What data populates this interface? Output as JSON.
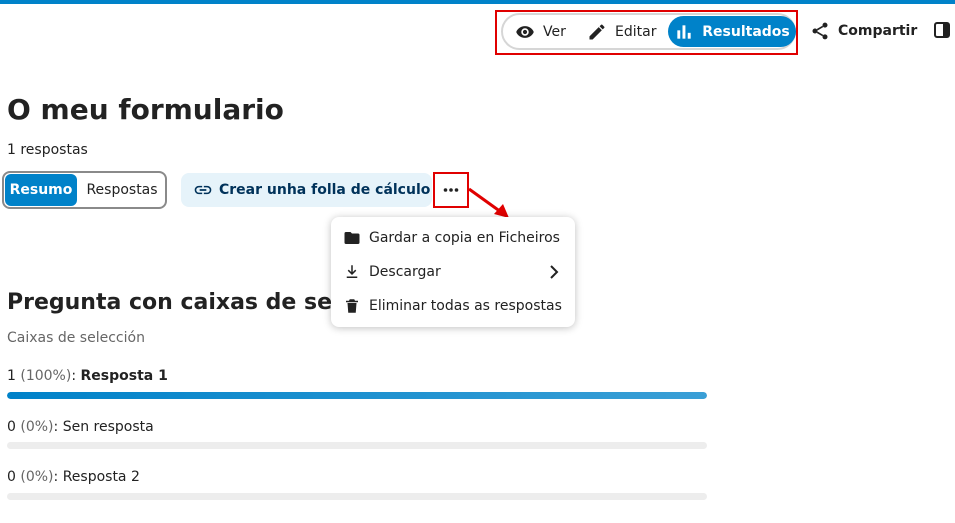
{
  "header": {
    "view_switch": {
      "ver_label": "Ver",
      "editar_label": "Editar",
      "resultados_label": "Resultados"
    },
    "share_label": "Compartir"
  },
  "main": {
    "title": "O meu formulario",
    "response_count": "1 respostas",
    "tabs": {
      "resumo": "Resumo",
      "respostas": "Respostas"
    },
    "sheet_button_label": "Crear unha folla de cálculo",
    "menu": {
      "items": [
        {
          "label": "Gardar a copia en Ficheiros",
          "icon": "folder-icon"
        },
        {
          "label": "Descargar",
          "icon": "download-icon"
        },
        {
          "label": "Eliminar todas as respostas",
          "icon": "trash-icon"
        }
      ]
    }
  },
  "question": {
    "title": "Pregunta con caixas de selección",
    "type": "Caixas de selección",
    "answers": [
      {
        "count": "1",
        "percent": "(100%)",
        "label": "Resposta 1",
        "fraction": 1.0,
        "bold": true
      },
      {
        "count": "0",
        "percent": "(0%)",
        "label": "Sen resposta",
        "fraction": 0.0,
        "bold": false
      },
      {
        "count": "0",
        "percent": "(0%)",
        "label": "Resposta 2",
        "fraction": 0.0,
        "bold": false
      }
    ]
  },
  "colors": {
    "accent": "#0082c9",
    "highlight": "#e00000"
  }
}
